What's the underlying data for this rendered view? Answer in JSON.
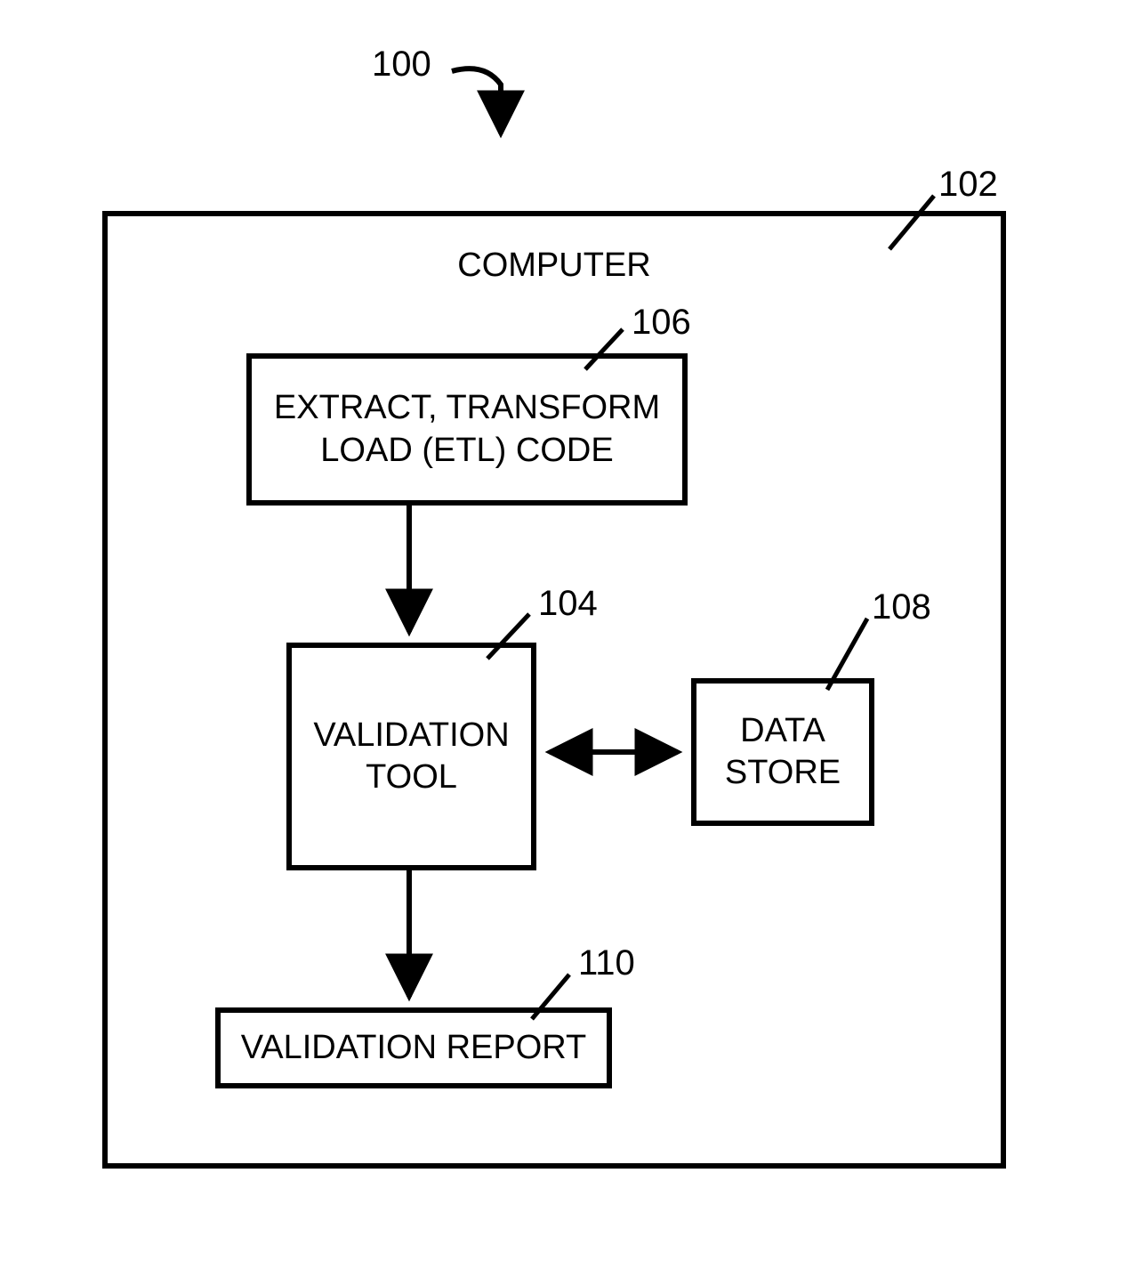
{
  "refs": {
    "system": "100",
    "computer": "102",
    "validation_tool": "104",
    "etl_code": "106",
    "data_store": "108",
    "validation_report": "110"
  },
  "labels": {
    "computer_title": "COMPUTER",
    "etl_code": "EXTRACT, TRANSFORM\nLOAD (ETL) CODE",
    "validation_tool": "VALIDATION\nTOOL",
    "data_store": "DATA\nSTORE",
    "validation_report": "VALIDATION REPORT"
  }
}
